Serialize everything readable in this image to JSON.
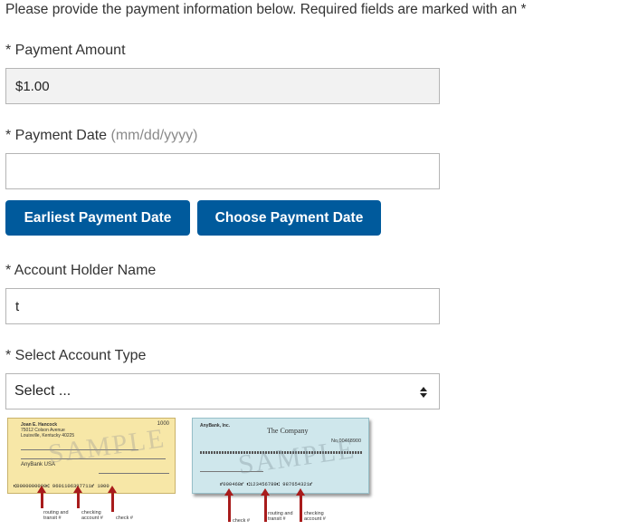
{
  "intro_text": "Please provide the payment information below. Required fields are marked with an *",
  "payment_amount": {
    "label": "* Payment Amount",
    "value": "$1.00"
  },
  "payment_date": {
    "label": "* Payment Date ",
    "hint": "(mm/dd/yyyy)",
    "value": ""
  },
  "buttons": {
    "earliest": "Earliest Payment Date",
    "choose": "Choose Payment Date"
  },
  "account_holder": {
    "label": "* Account Holder Name",
    "value": "t"
  },
  "account_type": {
    "label": "* Select Account Type",
    "selected": "Select ..."
  },
  "sample_checks": {
    "check_a": {
      "name_lines": [
        "Joan E. Hancock",
        "75012 Colson Avenue",
        "Louisville, Kentucky 40225"
      ],
      "number": "1000",
      "bank": "AnyBank USA",
      "watermark": "SAMPLE",
      "micr": "⑆0000000000⑆ 9601106397711⑈ 1000",
      "captions": [
        "routing and transit #",
        "checking account #",
        "check #"
      ]
    },
    "check_b": {
      "company": "The Company",
      "number": "No.00468900",
      "watermark": "SAMPLE",
      "micr": "⑈000468⑈ ⑆123456789⑆ 987654321⑈",
      "captions": [
        "check #",
        "routing and transit #",
        "checking account #"
      ]
    }
  },
  "colors": {
    "button_bg": "#005a9c",
    "button_text": "#ffffff",
    "field_border": "#b5b5b5",
    "arrow": "#a81c1c"
  }
}
